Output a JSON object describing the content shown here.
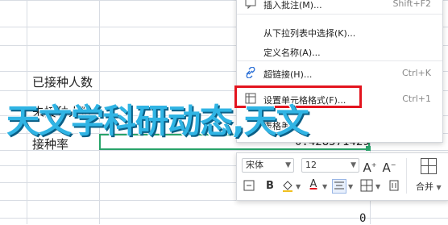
{
  "sheet": {
    "row_label_1": "已接种人数",
    "row_label_2": "未接种人数",
    "row_label_3": "接种率",
    "rate_value": "0.428571429",
    "partial_value": "0"
  },
  "overlay": {
    "title": "天文学科研动态,天文"
  },
  "context_menu": {
    "items": [
      {
        "label": "插入批注(M)...",
        "shortcut": "Shift+F2",
        "icon": "comment-icon"
      },
      {
        "label": "从下拉列表中选择(K)...",
        "shortcut": ""
      },
      {
        "label": "定义名称(A)...",
        "shortcut": ""
      },
      {
        "label": "超链接(H)...",
        "shortcut": "Ctrl+K",
        "icon": "link-icon"
      },
      {
        "label": "设置单元格格式(F)...",
        "shortcut": "Ctrl+1",
        "icon": "format-cells-icon"
      },
      {
        "label": "表格美化",
        "shortcut": ""
      }
    ]
  },
  "format_toolbar": {
    "font_name": "宋体",
    "font_size": "12",
    "merge_label": "合并"
  },
  "colors": {
    "accent": "#29a36a",
    "highlight": "#e3141e",
    "overlay_text": "#30b4e4"
  }
}
